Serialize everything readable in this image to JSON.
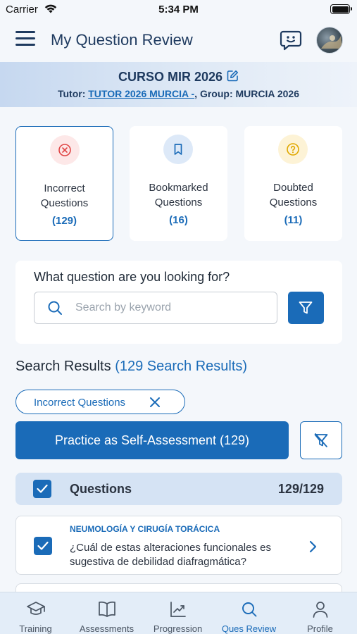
{
  "status_bar": {
    "carrier": "Carrier",
    "time": "5:34 PM"
  },
  "header": {
    "title": "My Question Review"
  },
  "course": {
    "name": "CURSO MIR 2026",
    "tutor_label": "Tutor:",
    "tutor_name": "TUTOR 2026 MURCIA -",
    "group_label": ", Group:",
    "group_name": "MURCIA 2026"
  },
  "stats": [
    {
      "label_line1": "Incorrect",
      "label_line2": "Questions",
      "count": "(129)",
      "icon": "x-circle-icon",
      "color": "#e04646"
    },
    {
      "label_line1": "Bookmarked",
      "label_line2": "Questions",
      "count": "(16)",
      "icon": "bookmark-icon",
      "color": "#1a6bb8"
    },
    {
      "label_line1": "Doubted",
      "label_line2": "Questions",
      "count": "(11)",
      "icon": "question-circle-icon",
      "color": "#e0a800"
    }
  ],
  "search": {
    "heading": "What question are you looking for?",
    "placeholder": "Search by keyword"
  },
  "results": {
    "label": "Search Results",
    "count_text": "(129 Search Results)"
  },
  "active_filter": {
    "label": "Incorrect Questions"
  },
  "practice_button": {
    "label": "Practice as Self-Assessment (129)"
  },
  "questions_header": {
    "label": "Questions",
    "count": "129/129"
  },
  "question_items": [
    {
      "category": "NEUMOLOGÍA Y CIRUGÍA TORÁCICA",
      "text": "¿Cuál de estas alteraciones funcionales es sugestiva de debilidad diafragmática?"
    }
  ],
  "tabs": [
    {
      "label": "Training",
      "icon": "mortarboard-icon"
    },
    {
      "label": "Assessments",
      "icon": "book-icon"
    },
    {
      "label": "Progression",
      "icon": "chart-icon"
    },
    {
      "label": "Ques Review",
      "icon": "search-icon",
      "active": true
    },
    {
      "label": "Profile",
      "icon": "user-icon"
    }
  ],
  "colors": {
    "primary": "#1a6bb8",
    "danger": "#e04646",
    "warning": "#e0a800",
    "background": "#f4f7fb"
  }
}
